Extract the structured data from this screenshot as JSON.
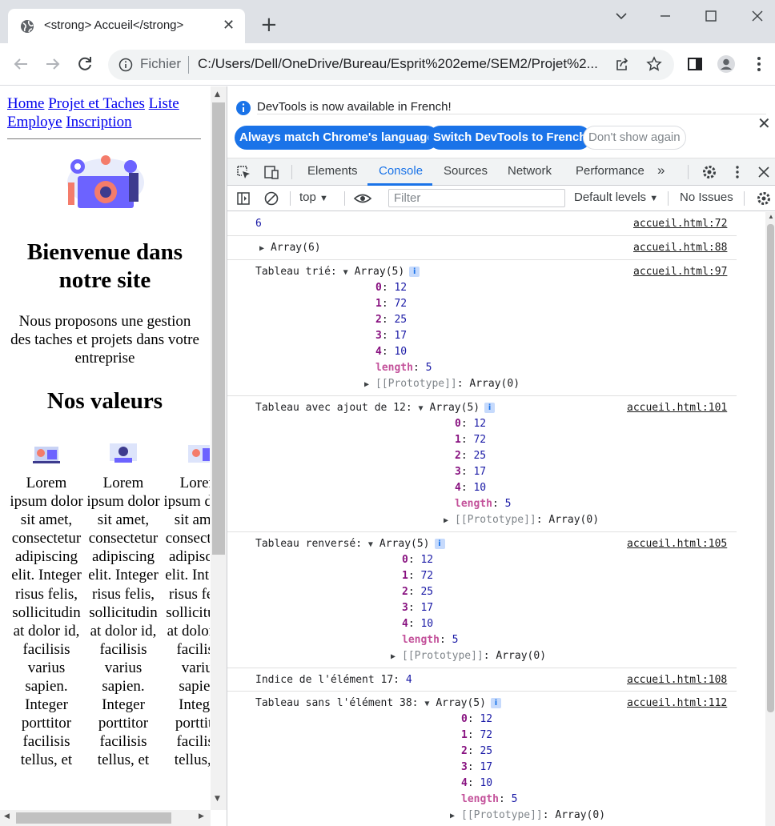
{
  "browser": {
    "tab_title": "<strong> Accueil</strong>",
    "omnibox_chip": "Fichier",
    "url": "C:/Users/Dell/OneDrive/Bureau/Esprit%202eme/SEM2/Projet%2..."
  },
  "page": {
    "nav": [
      "Home",
      "Projet et Taches",
      "Liste Employe",
      "Inscription"
    ],
    "heading": "Bienvenue dans notre site",
    "lead": "Nous proposons une gestion des taches et projets dans votre entreprise",
    "values_heading": "Nos valeurs",
    "column_text": "Lorem ipsum dolor sit amet, consectetur adipiscing elit. Integer risus felis, sollicitudin at dolor id, facilisis varius sapien. Integer porttitor facilisis tellus, et"
  },
  "devtools": {
    "infobar_message": "DevTools is now available in French!",
    "btn_match": "Always match Chrome's language",
    "btn_switch": "Switch DevTools to French",
    "btn_dismiss": "Don't show again",
    "tabs": [
      "Elements",
      "Console",
      "Sources",
      "Network",
      "Performance"
    ],
    "active_tab": "Console",
    "context": "top",
    "filter_placeholder": "Filter",
    "levels": "Default levels",
    "issues": "No Issues"
  },
  "console": {
    "messages": [
      {
        "text": "6",
        "src": "accueil.html:72"
      },
      {
        "text": "Array(6)",
        "src": "accueil.html:88"
      },
      {
        "label": "Tableau trié:",
        "array_label": "Array(5)",
        "src": "accueil.html:97",
        "entries": [
          [
            "0",
            "12"
          ],
          [
            "1",
            "72"
          ],
          [
            "2",
            "25"
          ],
          [
            "3",
            "17"
          ],
          [
            "4",
            "10"
          ]
        ],
        "length": "5",
        "proto": "[[Prototype]]: Array(0)"
      },
      {
        "label": "Tableau avec ajout de 12:",
        "array_label": "Array(5)",
        "src": "accueil.html:101",
        "entries": [
          [
            "0",
            "12"
          ],
          [
            "1",
            "72"
          ],
          [
            "2",
            "25"
          ],
          [
            "3",
            "17"
          ],
          [
            "4",
            "10"
          ]
        ],
        "length": "5",
        "proto": "[[Prototype]]: Array(0)"
      },
      {
        "label": "Tableau renversé:",
        "array_label": "Array(5)",
        "src": "accueil.html:105",
        "entries": [
          [
            "0",
            "12"
          ],
          [
            "1",
            "72"
          ],
          [
            "2",
            "25"
          ],
          [
            "3",
            "17"
          ],
          [
            "4",
            "10"
          ]
        ],
        "length": "5",
        "proto": "[[Prototype]]: Array(0)"
      },
      {
        "label": "Indice de l'élément 17:",
        "value": "4",
        "src": "accueil.html:108"
      },
      {
        "label": "Tableau sans l'élément 38:",
        "array_label": "Array(5)",
        "src": "accueil.html:112",
        "entries": [
          [
            "0",
            "12"
          ],
          [
            "1",
            "72"
          ],
          [
            "2",
            "25"
          ],
          [
            "3",
            "17"
          ],
          [
            "4",
            "10"
          ]
        ],
        "length": "5",
        "proto": "[[Prototype]]: Array(0)"
      }
    ]
  },
  "colors": {
    "accent": "#1a73e8",
    "link": "#0000ee",
    "key": "#881280",
    "number": "#1a1aa6"
  }
}
